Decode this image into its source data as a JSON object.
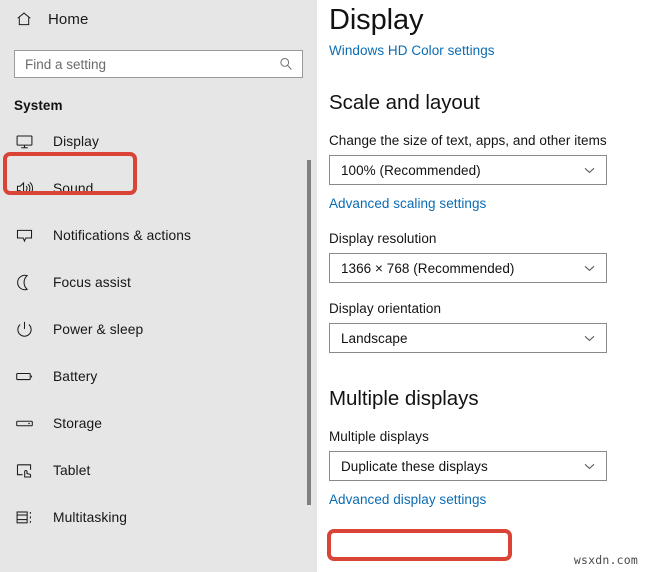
{
  "sidebar": {
    "home": {
      "label": "Home",
      "icon": "home-icon"
    },
    "search": {
      "placeholder": "Find a setting",
      "value": "",
      "icon": "search-icon"
    },
    "section_label": "System",
    "items": [
      {
        "label": "Display",
        "icon": "monitor-icon",
        "selected": true
      },
      {
        "label": "Sound",
        "icon": "speaker-icon",
        "selected": false
      },
      {
        "label": "Notifications & actions",
        "icon": "notification-bubble-icon",
        "selected": false
      },
      {
        "label": "Focus assist",
        "icon": "moon-icon",
        "selected": false
      },
      {
        "label": "Power & sleep",
        "icon": "power-icon",
        "selected": false
      },
      {
        "label": "Battery",
        "icon": "battery-icon",
        "selected": false
      },
      {
        "label": "Storage",
        "icon": "storage-drive-icon",
        "selected": false
      },
      {
        "label": "Tablet",
        "icon": "tablet-touch-icon",
        "selected": false
      },
      {
        "label": "Multitasking",
        "icon": "multitasking-icon",
        "selected": false
      }
    ]
  },
  "main": {
    "title": "Display",
    "hd_color_link": "Windows HD Color settings",
    "scale_section": {
      "heading": "Scale and layout",
      "scale_label": "Change the size of text, apps, and other items",
      "scale_value": "100% (Recommended)",
      "advanced_scaling_link": "Advanced scaling settings",
      "resolution_label": "Display resolution",
      "resolution_value": "1366 × 768 (Recommended)",
      "orientation_label": "Display orientation",
      "orientation_value": "Landscape"
    },
    "multiple_section": {
      "heading": "Multiple displays",
      "multiple_label": "Multiple displays",
      "multiple_value": "Duplicate these displays",
      "advanced_display_link": "Advanced display settings"
    }
  },
  "annotations": {
    "highlight_color": "#d94436",
    "accent_link_color": "#0b6cb3",
    "sidebar_bg": "#e6e6e6"
  },
  "watermark": {
    "text": "wsxdn.com"
  }
}
